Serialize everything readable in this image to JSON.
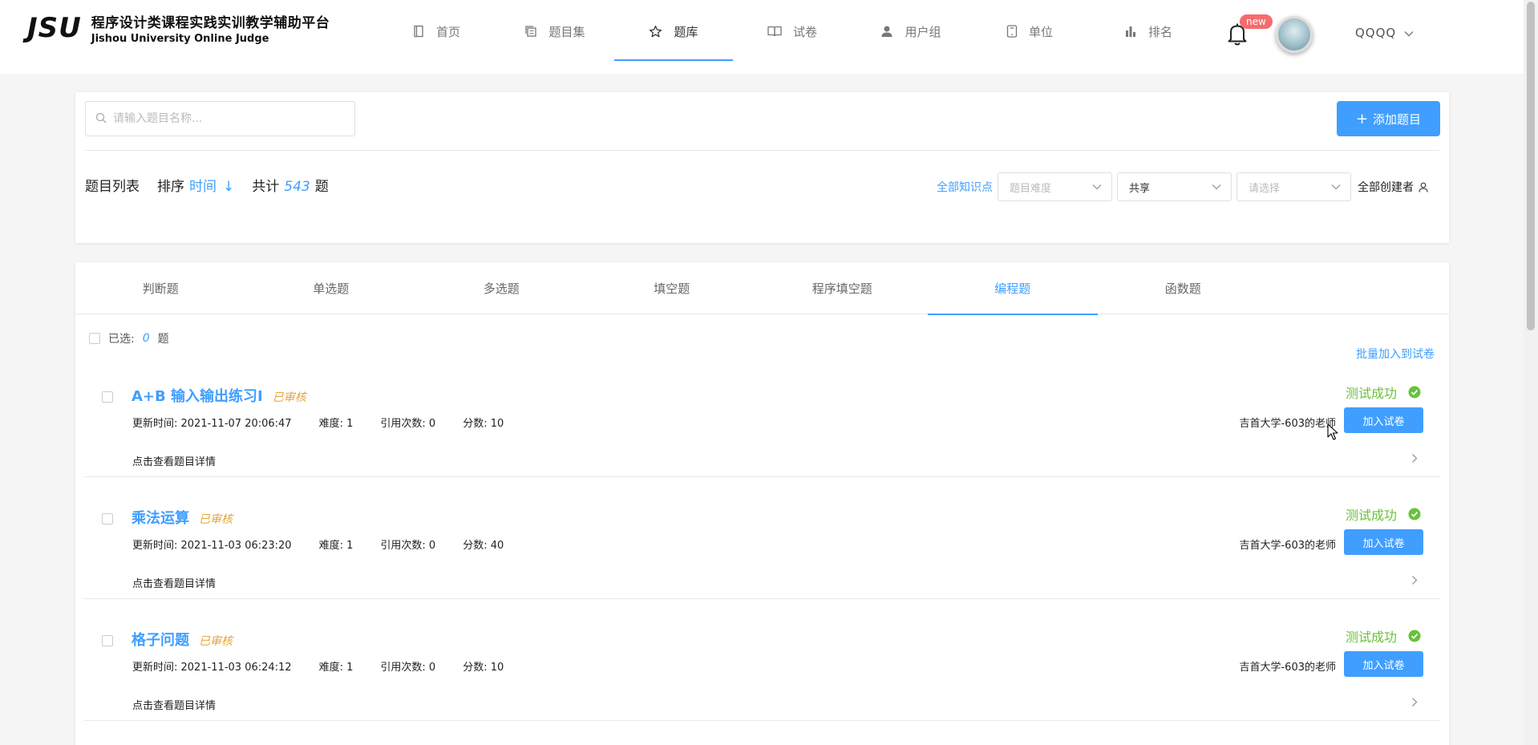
{
  "logo": {
    "mark": "JSU",
    "title_cn": "程序设计类课程实践实训教学辅助平台",
    "title_en": "Jishou University Online Judge"
  },
  "nav": [
    {
      "label": "首页",
      "icon": "book-icon"
    },
    {
      "label": "题目集",
      "icon": "copy-icon"
    },
    {
      "label": "题库",
      "icon": "star-icon",
      "active": true
    },
    {
      "label": "试卷",
      "icon": "open-book-icon"
    },
    {
      "label": "用户组",
      "icon": "user-icon"
    },
    {
      "label": "单位",
      "icon": "tablet-icon"
    },
    {
      "label": "排名",
      "icon": "bar-chart-icon"
    }
  ],
  "header": {
    "badge": "new",
    "username": "QQQQ"
  },
  "filters": {
    "search_placeholder": "请输入题目名称...",
    "add_button": "添加题目",
    "list_label": "题目列表",
    "sort_label": "排序",
    "sort_value": "时间",
    "sort_arrow": "↓",
    "total_prefix": "共计",
    "total_count": "543",
    "total_suffix": "题",
    "knowledge": "全部知识点",
    "difficulty_placeholder": "题目难度",
    "share_value": "共享",
    "select_placeholder": "请选择",
    "creator": "全部创建者"
  },
  "tabs": [
    "判断题",
    "单选题",
    "多选题",
    "填空题",
    "程序填空题",
    "编程题",
    "函数题"
  ],
  "active_tab": 5,
  "selection": {
    "prefix": "已选:",
    "count": "0",
    "suffix": "题",
    "batch_add": "批量加入到试卷"
  },
  "items": [
    {
      "title": "A+B 输入输出练习I",
      "status": "已审核",
      "updated": "更新时间: 2021-11-07 20:06:47",
      "difficulty": "难度: 1",
      "refs": "引用次数: 0",
      "score": "分数: 10",
      "detail": "点击查看题目详情",
      "test": "测试成功",
      "author": "吉首大学-603的老师",
      "join": "加入试卷"
    },
    {
      "title": "乘法运算",
      "status": "已审核",
      "updated": "更新时间: 2021-11-03 06:23:20",
      "difficulty": "难度: 1",
      "refs": "引用次数: 0",
      "score": "分数: 40",
      "detail": "点击查看题目详情",
      "test": "测试成功",
      "author": "吉首大学-603的老师",
      "join": "加入试卷"
    },
    {
      "title": "格子问题",
      "status": "已审核",
      "updated": "更新时间: 2021-11-03 06:24:12",
      "difficulty": "难度: 1",
      "refs": "引用次数: 0",
      "score": "分数: 10",
      "detail": "点击查看题目详情",
      "test": "测试成功",
      "author": "吉首大学-603的老师",
      "join": "加入试卷"
    }
  ],
  "colors": {
    "primary": "#409eff",
    "success": "#67c23a",
    "warning": "#e6a23c",
    "badge": "#f56c6c"
  }
}
